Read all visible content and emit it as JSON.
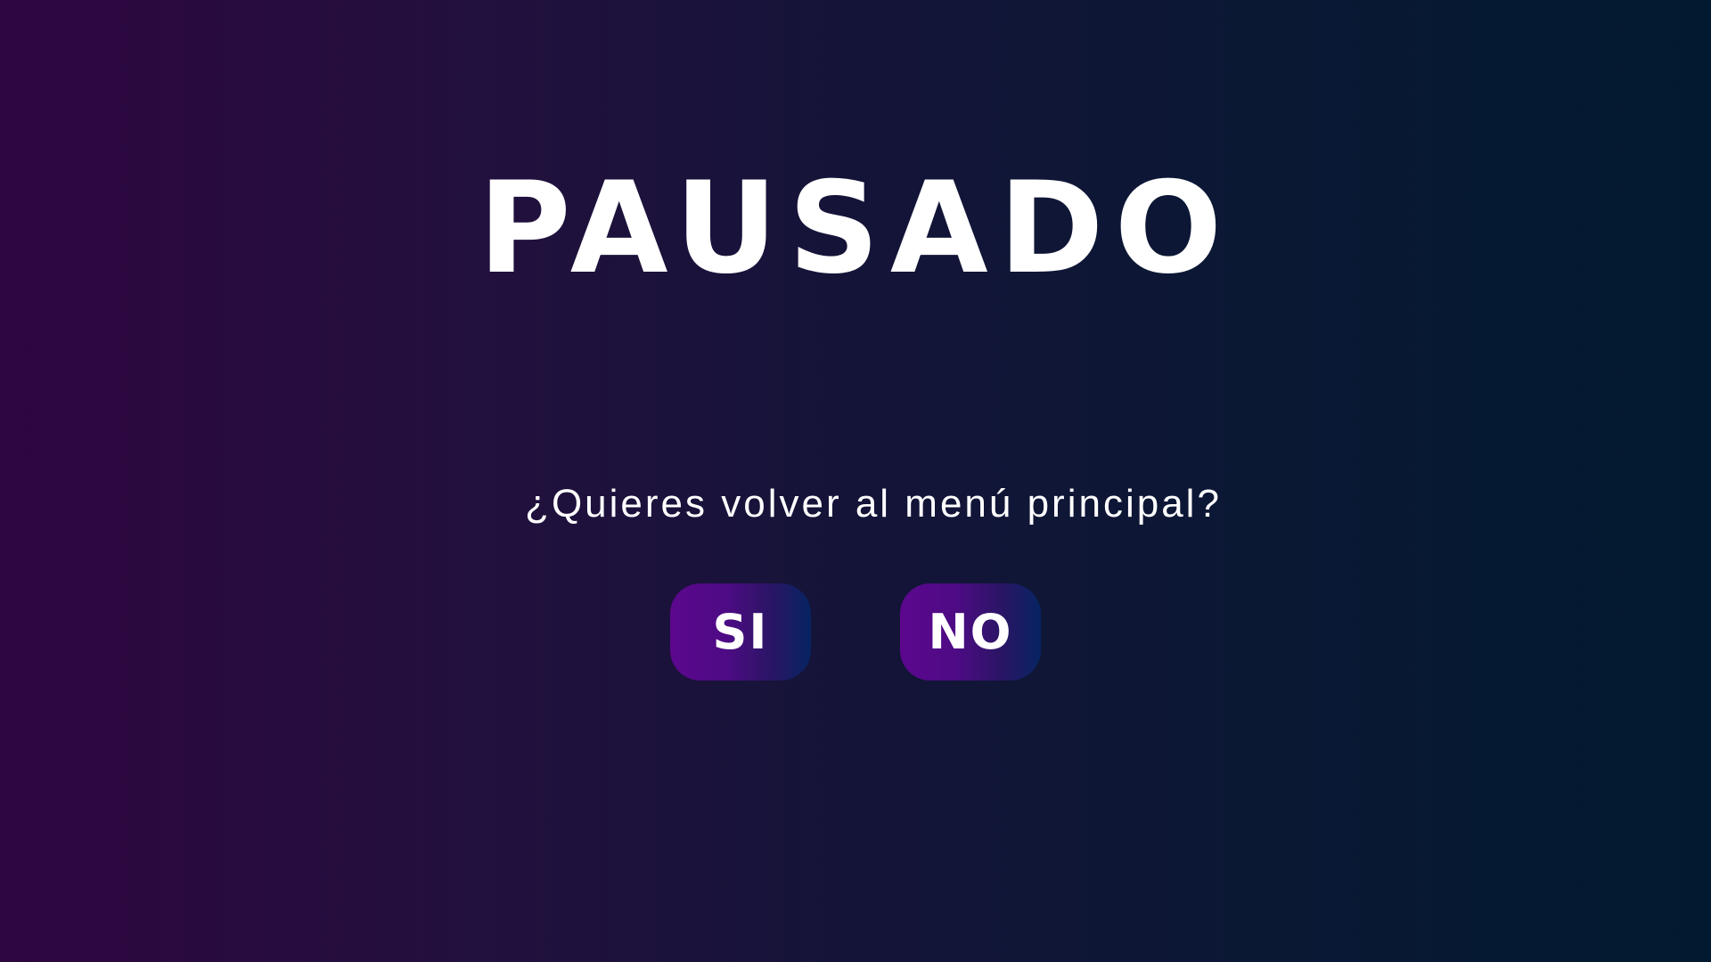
{
  "pause_screen": {
    "title": "PAUSADO",
    "question": "¿Quieres volver al menú principal?",
    "yes_label": "SI",
    "no_label": "NO"
  },
  "colors": {
    "background_left": "#2e0640",
    "background_right": "#021a30",
    "button_left": "#5c078e",
    "button_right": "#062462",
    "text": "#ffffff"
  }
}
